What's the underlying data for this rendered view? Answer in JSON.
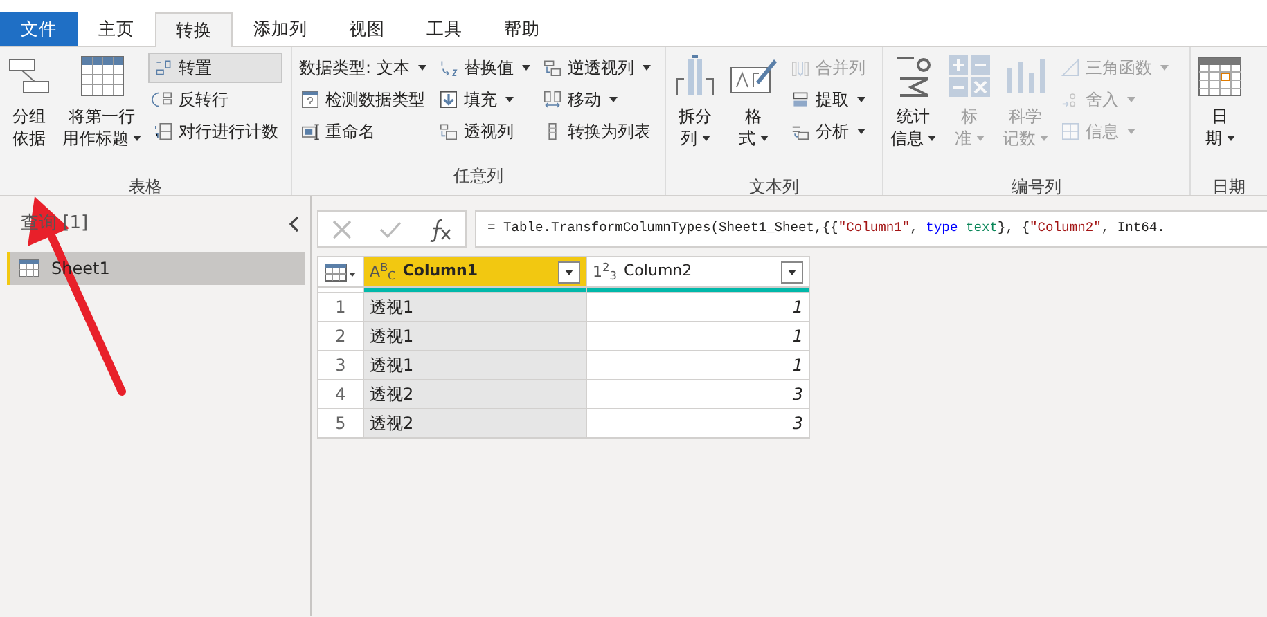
{
  "tabs": [
    {
      "label": "文件",
      "kind": "file",
      "selected": false
    },
    {
      "label": "主页",
      "kind": "tab",
      "selected": false
    },
    {
      "label": "转换",
      "kind": "tab",
      "selected": true
    },
    {
      "label": "添加列",
      "kind": "tab",
      "selected": false
    },
    {
      "label": "视图",
      "kind": "tab",
      "selected": false
    },
    {
      "label": "工具",
      "kind": "tab",
      "selected": false
    },
    {
      "label": "帮助",
      "kind": "tab",
      "selected": false
    }
  ],
  "ribbon": {
    "groups": [
      {
        "label": "表格",
        "items": [
          {
            "kind": "large",
            "lines": [
              "分组",
              "依据"
            ],
            "dropdown": false,
            "disabled": false
          },
          {
            "kind": "large",
            "lines": [
              "将第一行",
              "用作标题"
            ],
            "dropdown": true,
            "disabled": false
          },
          {
            "kind": "column",
            "buttons": [
              {
                "label": "转置",
                "dropdown": false,
                "disabled": false,
                "highlighted": true
              },
              {
                "label": "反转行",
                "dropdown": false,
                "disabled": false,
                "highlighted": false
              },
              {
                "label": "对行进行计数",
                "dropdown": false,
                "disabled": false,
                "highlighted": false
              }
            ]
          }
        ]
      },
      {
        "label": "任意列",
        "items": [
          {
            "kind": "column",
            "buttons": [
              {
                "label": "数据类型: 文本",
                "dropdown": true,
                "disabled": false,
                "highlighted": false
              },
              {
                "label": "检测数据类型",
                "dropdown": false,
                "disabled": false,
                "highlighted": false
              },
              {
                "label": "重命名",
                "dropdown": false,
                "disabled": false,
                "highlighted": false
              }
            ]
          },
          {
            "kind": "column",
            "buttons": [
              {
                "label": "替换值",
                "dropdown": true,
                "disabled": false,
                "highlighted": false
              },
              {
                "label": "填充",
                "dropdown": true,
                "disabled": false,
                "highlighted": false
              },
              {
                "label": "透视列",
                "dropdown": false,
                "disabled": false,
                "highlighted": false
              }
            ]
          },
          {
            "kind": "column",
            "buttons": [
              {
                "label": "逆透视列",
                "dropdown": true,
                "disabled": false,
                "highlighted": false
              },
              {
                "label": "移动",
                "dropdown": true,
                "disabled": false,
                "highlighted": false
              },
              {
                "label": "转换为列表",
                "dropdown": false,
                "disabled": false,
                "highlighted": false
              }
            ]
          }
        ]
      },
      {
        "label": "文本列",
        "items": [
          {
            "kind": "large",
            "lines": [
              "拆分",
              "列"
            ],
            "dropdown": true,
            "disabled": false
          },
          {
            "kind": "large",
            "lines": [
              "格",
              "式"
            ],
            "dropdown": true,
            "disabled": false
          },
          {
            "kind": "column",
            "buttons": [
              {
                "label": "合并列",
                "dropdown": false,
                "disabled": true,
                "highlighted": false
              },
              {
                "label": "提取",
                "dropdown": true,
                "disabled": false,
                "highlighted": false
              },
              {
                "label": "分析",
                "dropdown": true,
                "disabled": false,
                "highlighted": false
              }
            ]
          }
        ]
      },
      {
        "label": "编号列",
        "items": [
          {
            "kind": "large",
            "lines": [
              "统计",
              "信息"
            ],
            "dropdown": true,
            "disabled": false
          },
          {
            "kind": "large",
            "lines": [
              "标",
              "准"
            ],
            "dropdown": true,
            "disabled": true
          },
          {
            "kind": "large",
            "lines": [
              "科学",
              "记数"
            ],
            "dropdown": true,
            "disabled": true
          },
          {
            "kind": "column",
            "buttons": [
              {
                "label": "三角函数",
                "dropdown": true,
                "disabled": true,
                "highlighted": false
              },
              {
                "label": "舍入",
                "dropdown": true,
                "disabled": true,
                "highlighted": false
              },
              {
                "label": "信息",
                "dropdown": true,
                "disabled": true,
                "highlighted": false
              }
            ]
          }
        ]
      },
      {
        "label": "日期",
        "items": [
          {
            "kind": "large",
            "lines": [
              "日",
              "期"
            ],
            "dropdown": true,
            "disabled": false
          }
        ]
      }
    ]
  },
  "queries": {
    "title": "查询 [1]",
    "items": [
      {
        "label": "Sheet1",
        "selected": true
      }
    ]
  },
  "formula": {
    "segments": [
      {
        "text": "= Table.TransformColumnTypes(Sheet1_Sheet,{{",
        "kind": "plain"
      },
      {
        "text": "\"Column1\"",
        "kind": "string"
      },
      {
        "text": ", ",
        "kind": "plain"
      },
      {
        "text": "type ",
        "kind": "keyword"
      },
      {
        "text": "text",
        "kind": "type"
      },
      {
        "text": "}, {",
        "kind": "plain"
      },
      {
        "text": "\"Column2\"",
        "kind": "string"
      },
      {
        "text": ", Int64.",
        "kind": "plain"
      }
    ]
  },
  "table": {
    "columns": [
      {
        "name": "Column1",
        "type_glyph": "A$^{B}$$_{C}$",
        "selected": true
      },
      {
        "name": "Column2",
        "type_glyph": "1$^{2}$$_{3}$",
        "selected": false
      }
    ],
    "rows": [
      {
        "index": "1",
        "cells": [
          "透视1",
          "1"
        ]
      },
      {
        "index": "2",
        "cells": [
          "透视1",
          "1"
        ]
      },
      {
        "index": "3",
        "cells": [
          "透视1",
          "1"
        ]
      },
      {
        "index": "4",
        "cells": [
          "透视2",
          "3"
        ]
      },
      {
        "index": "5",
        "cells": [
          "透视2",
          "3"
        ]
      }
    ]
  }
}
